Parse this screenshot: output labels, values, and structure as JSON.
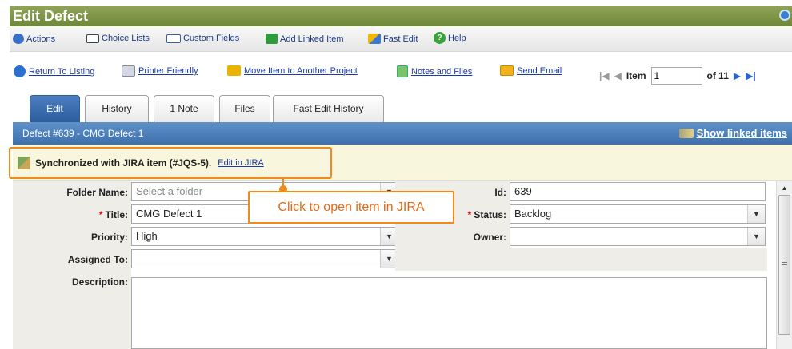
{
  "window": {
    "title": "Edit Defect"
  },
  "toolbar": {
    "actions": "Actions",
    "choice_lists": "Choice Lists",
    "custom_fields": "Custom Fields",
    "add_linked_item": "Add Linked Item",
    "fast_edit": "Fast Edit",
    "help": "Help"
  },
  "links": {
    "return_to_listing": "Return To Listing",
    "printer_friendly": "Printer Friendly",
    "move_item": "Move Item to Another Project",
    "notes_and_files": "Notes and Files",
    "send_email": "Send Email"
  },
  "pager": {
    "item_label": "Item",
    "item_value": "1",
    "of_label": "of 11"
  },
  "tabs": [
    "Edit",
    "History",
    "1 Note",
    "Files",
    "Fast Edit History"
  ],
  "defect": {
    "header": "Defect #639 - CMG Defect 1",
    "show_linked": "Show linked items"
  },
  "sync": {
    "message": "Synchronized with JIRA item (#JQS-5).",
    "link": "Edit in JIRA"
  },
  "callout": {
    "text": "Click to open item in JIRA"
  },
  "form": {
    "folder_name": {
      "label": "Folder Name:",
      "placeholder": "Select a folder"
    },
    "id": {
      "label": "Id:",
      "value": "639"
    },
    "title": {
      "label": "Title:",
      "value": "CMG Defect 1"
    },
    "status": {
      "label": "Status:",
      "value": "Backlog"
    },
    "priority": {
      "label": "Priority:",
      "value": "High"
    },
    "owner": {
      "label": "Owner:",
      "value": ""
    },
    "assigned_to": {
      "label": "Assigned To:",
      "value": ""
    },
    "description": {
      "label": "Description:"
    }
  },
  "colors": {
    "title_bar": "#7a9040",
    "header_blue": "#4a7cba",
    "callout_orange": "#f08a1a",
    "link_blue": "#1a3aa8"
  }
}
